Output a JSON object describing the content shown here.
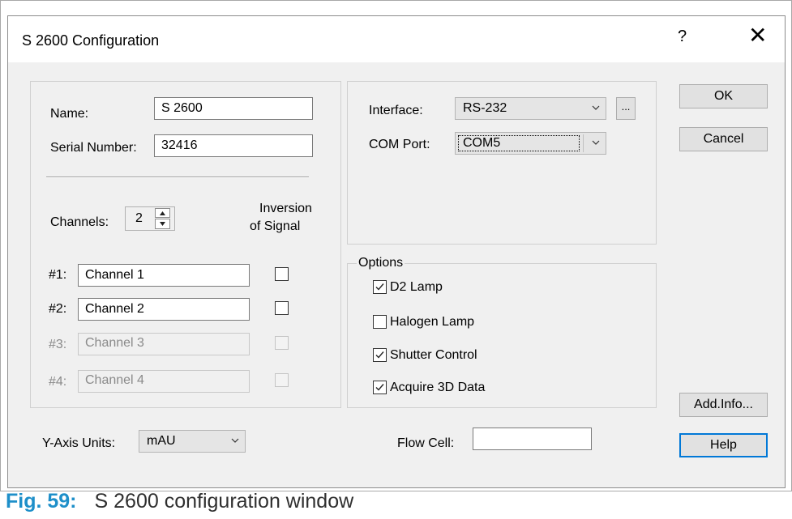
{
  "dialog": {
    "title": "S 2600 Configuration",
    "help_glyph": "?",
    "close_glyph": "✕"
  },
  "device": {
    "name_label": "Name:",
    "name_value": "S 2600",
    "serial_label": "Serial Number:",
    "serial_value": "32416"
  },
  "channels": {
    "label": "Channels:",
    "count": "2",
    "inversion_header_line1": "Inversion",
    "inversion_header_line2": "of Signal",
    "rows": [
      {
        "label": "#1:",
        "value": "Channel 1",
        "enabled": true,
        "inverted": false
      },
      {
        "label": "#2:",
        "value": "Channel 2",
        "enabled": true,
        "inverted": false
      },
      {
        "label": "#3:",
        "value": "Channel 3",
        "enabled": false,
        "inverted": false
      },
      {
        "label": "#4:",
        "value": "Channel 4",
        "enabled": false,
        "inverted": false
      }
    ]
  },
  "connection": {
    "interface_label": "Interface:",
    "interface_value": "RS-232",
    "browse_label": "...",
    "com_label": "COM Port:",
    "com_value": "COM5"
  },
  "options": {
    "title": "Options",
    "items": [
      {
        "label": "D2 Lamp",
        "checked": true
      },
      {
        "label": "Halogen Lamp",
        "checked": false
      },
      {
        "label": "Shutter Control",
        "checked": true
      },
      {
        "label": "Acquire 3D Data",
        "checked": true
      }
    ]
  },
  "yaxis": {
    "label": "Y-Axis Units:",
    "value": "mAU"
  },
  "flowcell": {
    "label": "Flow Cell:",
    "value": ""
  },
  "buttons": {
    "ok": "OK",
    "cancel": "Cancel",
    "addinfo": "Add.Info...",
    "help": "Help"
  },
  "caption": {
    "figure": "Fig. 59:",
    "text": "S 2600 configuration window"
  },
  "colors": {
    "caption_accent": "#1e8fc9",
    "focus_border": "#0078d7"
  }
}
